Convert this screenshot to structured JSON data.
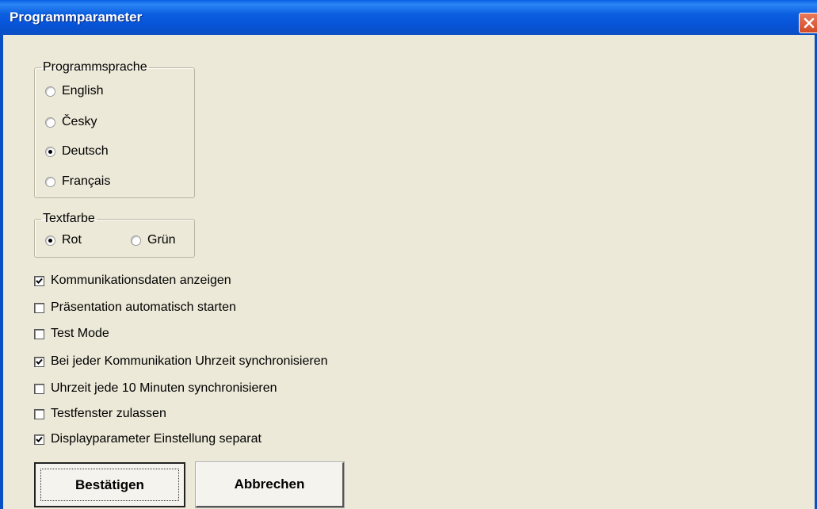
{
  "window": {
    "title": "Programmparameter"
  },
  "language_group": {
    "legend": "Programmsprache",
    "options": [
      {
        "label": "English",
        "selected": false
      },
      {
        "label": "Česky",
        "selected": false
      },
      {
        "label": "Deutsch",
        "selected": true
      },
      {
        "label": "Français",
        "selected": false
      }
    ]
  },
  "color_group": {
    "legend": "Textfarbe",
    "options": [
      {
        "label": "Rot",
        "selected": true
      },
      {
        "label": "Grün",
        "selected": false
      }
    ]
  },
  "checkboxes": [
    {
      "label": "Kommunikationsdaten anzeigen",
      "checked": true
    },
    {
      "label": "Präsentation automatisch starten",
      "checked": false
    },
    {
      "label": "Test Mode",
      "checked": false
    },
    {
      "label": "Bei jeder Kommunikation Uhrzeit synchronisieren",
      "checked": true
    },
    {
      "label": "Uhrzeit jede 10 Minuten synchronisieren",
      "checked": false
    },
    {
      "label": "Testfenster zulassen",
      "checked": false
    },
    {
      "label": "Displayparameter Einstellung separat",
      "checked": true
    }
  ],
  "buttons": {
    "confirm": "Bestätigen",
    "cancel": "Abbrechen"
  },
  "colors": {
    "titlebar": "#0a5ee6",
    "background": "#ece9d8",
    "close": "#d24a26"
  }
}
